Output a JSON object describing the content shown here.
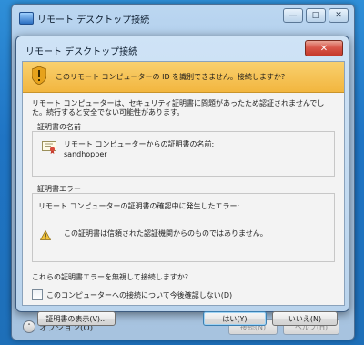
{
  "back_window": {
    "title": "リモート デスクトップ接続",
    "minimize_glyph": "—",
    "maximize_glyph": "□",
    "close_glyph": "✕",
    "options_label": "オプション(O)",
    "connect_label": "接続(N)",
    "help_label": "ヘルプ(H)"
  },
  "dialog": {
    "title": "リモート デスクトップ接続",
    "close_glyph": "✕",
    "banner": "このリモート コンピューターの ID を識別できません。接続しますか?",
    "description": "リモート コンピューターは、セキュリティ証明書に問題があったため認証されませんでした。続行すると安全でない可能性があります。",
    "cert_name_group": {
      "label": "証明書の名前",
      "line1": "リモート コンピューターからの証明書の名前:",
      "line2": "sandhopper"
    },
    "cert_error_group": {
      "label": "証明書エラー",
      "intro": "リモート コンピューターの証明書の確認中に発生したエラー:",
      "error": "この証明書は信頼された認証機関からのものではありません。"
    },
    "question": "これらの証明書エラーを無視して接続しますか?",
    "checkbox_label": "このコンピューターへの接続について今後確認しない(D)",
    "buttons": {
      "view_cert": "証明書の表示(V)...",
      "yes": "はい(Y)",
      "no": "いいえ(N)"
    }
  },
  "colors": {
    "banner": "#f2b63f",
    "desktop": "#1f74c4",
    "close": "#c4392a"
  }
}
